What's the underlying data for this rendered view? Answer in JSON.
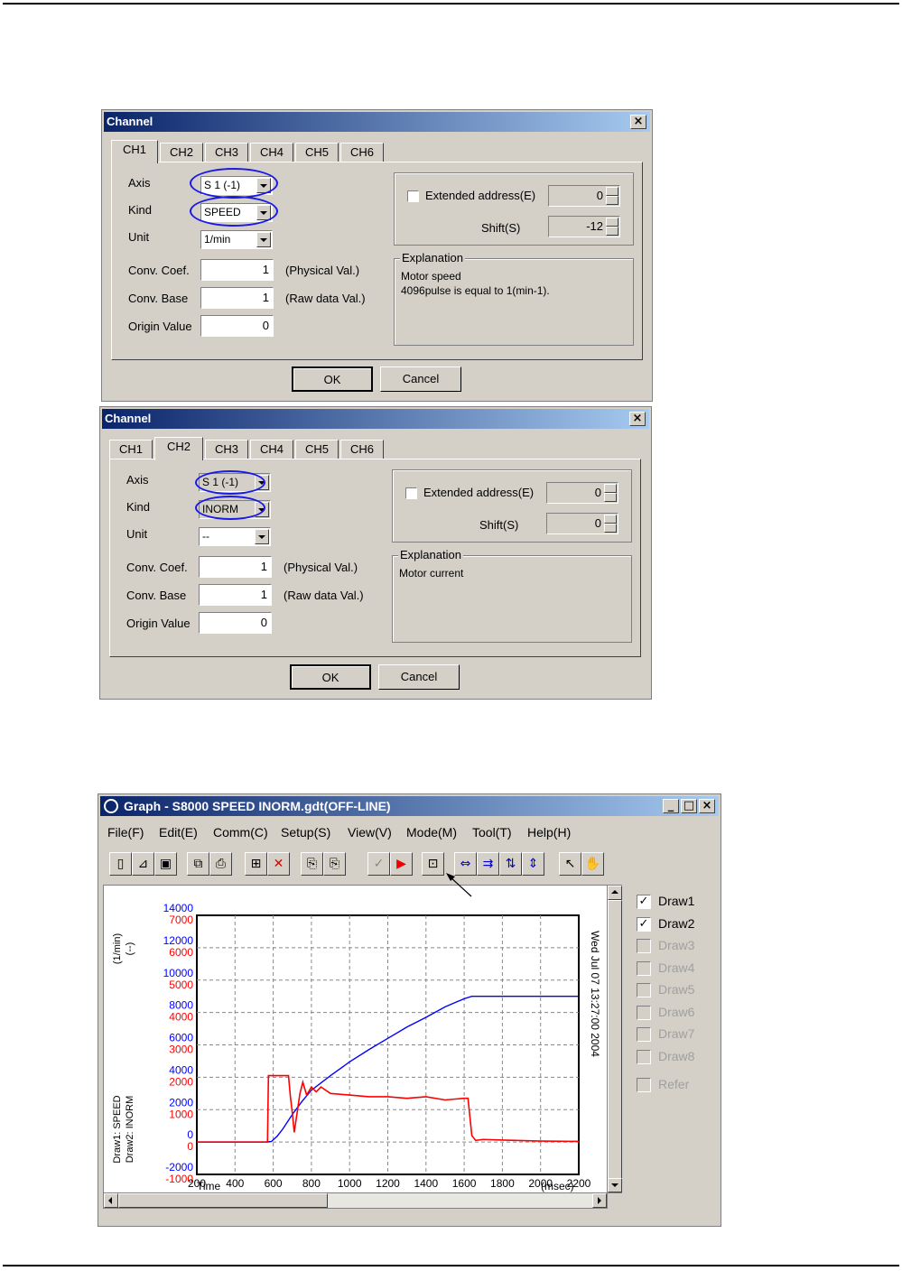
{
  "dialog1": {
    "title": "Channel",
    "tabs": [
      "CH1",
      "CH2",
      "CH3",
      "CH4",
      "CH5",
      "CH6"
    ],
    "active_tab": "CH1",
    "labels": {
      "axis": "Axis",
      "kind": "Kind",
      "unit": "Unit",
      "conv_coef": "Conv. Coef.",
      "conv_base": "Conv. Base",
      "origin": "Origin Value"
    },
    "axis_value": "S 1 (-1)",
    "kind_value": "SPEED",
    "unit_value": "1/min",
    "conv_coef": "1",
    "conv_base": "1",
    "origin_value": "0",
    "physical_suffix": "(Physical Val.)",
    "raw_suffix": "(Raw data Val.)",
    "extended_label": "Extended address(E)",
    "extended_value": "0",
    "shift_label": "Shift(S)",
    "shift_value": "-12",
    "explanation_title": "Explanation",
    "explanation_line1": "Motor speed",
    "explanation_line2": "4096pulse is equal to 1(min-1).",
    "ok": "OK",
    "cancel": "Cancel"
  },
  "dialog2": {
    "title": "Channel",
    "tabs": [
      "CH1",
      "CH2",
      "CH3",
      "CH4",
      "CH5",
      "CH6"
    ],
    "active_tab": "CH2",
    "labels": {
      "axis": "Axis",
      "kind": "Kind",
      "unit": "Unit",
      "conv_coef": "Conv. Coef.",
      "conv_base": "Conv. Base",
      "origin": "Origin Value"
    },
    "axis_value": "S 1 (-1)",
    "kind_value": "INORM",
    "unit_value": "--",
    "conv_coef": "1",
    "conv_base": "1",
    "origin_value": "0",
    "physical_suffix": "(Physical Val.)",
    "raw_suffix": "(Raw data Val.)",
    "extended_label": "Extended address(E)",
    "extended_value": "0",
    "shift_label": "Shift(S)",
    "shift_value": "0",
    "explanation_title": "Explanation",
    "explanation_line1": "Motor current",
    "explanation_line2": "",
    "ok": "OK",
    "cancel": "Cancel"
  },
  "graph": {
    "title": "Graph - S8000 SPEED INORM.gdt(OFF-LINE)",
    "menu": [
      "File(F)",
      "Edit(E)",
      "Comm(C)",
      "Setup(S)",
      "View(V)",
      "Mode(M)",
      "Tool(T)",
      "Help(H)"
    ],
    "window_buttons": [
      "_",
      "□",
      "×"
    ],
    "toolbar_icons": [
      "new-file-icon",
      "open-folder-icon",
      "save-disk-icon",
      "copy-icon",
      "print-icon",
      "channel-setup-icon",
      "delete-icon",
      "paste-icon",
      "export-icon",
      "trigger-icon",
      "play-icon",
      "fit-frame-icon",
      "zoom-x-icon",
      "shift-x-icon",
      "shift-y-icon",
      "zoom-y-icon",
      "pointer-icon",
      "hand-icon"
    ],
    "draw_items": [
      {
        "label": "Draw1",
        "checked": true,
        "enabled": true
      },
      {
        "label": "Draw2",
        "checked": true,
        "enabled": true
      },
      {
        "label": "Draw3",
        "checked": false,
        "enabled": false
      },
      {
        "label": "Draw4",
        "checked": false,
        "enabled": false
      },
      {
        "label": "Draw5",
        "checked": false,
        "enabled": false
      },
      {
        "label": "Draw6",
        "checked": false,
        "enabled": false
      },
      {
        "label": "Draw7",
        "checked": false,
        "enabled": false
      },
      {
        "label": "Draw8",
        "checked": false,
        "enabled": false
      },
      {
        "label": "Refer",
        "checked": false,
        "enabled": false
      }
    ],
    "unit_left": "(1/min)",
    "unit_right": "(--)",
    "draw_legend_1": "Draw1: SPEED",
    "draw_legend_2": "Draw2: INORM",
    "timestamp": "Wed Jul 07 13:27:00 2004",
    "colors": {
      "speed": "#0000ff",
      "inorm": "#ff0000"
    }
  },
  "chart_data": {
    "type": "line",
    "xlabel": "Time",
    "x_unit": "(msec)",
    "xlim": [
      200,
      2200
    ],
    "x_ticks": [
      200,
      400,
      600,
      800,
      1000,
      1200,
      1400,
      1600,
      1800,
      2000,
      2200
    ],
    "y_ticks_speed": [
      -2000,
      0,
      2000,
      4000,
      6000,
      8000,
      10000,
      12000,
      14000
    ],
    "y_ticks_inorm": [
      -1000,
      0,
      1000,
      2000,
      3000,
      4000,
      5000,
      6000,
      7000
    ],
    "ylim_speed": [
      -2000,
      14000
    ],
    "ylim_inorm": [
      -1000,
      7000
    ],
    "grid": true,
    "series": [
      {
        "name": "SPEED",
        "color": "#0000ff",
        "x": [
          200,
          560,
          590,
          620,
          650,
          700,
          750,
          800,
          900,
          1000,
          1100,
          1200,
          1300,
          1400,
          1500,
          1600,
          1640,
          1800,
          2000,
          2200
        ],
        "y": [
          0,
          0,
          30,
          350,
          800,
          1700,
          2500,
          3200,
          4100,
          4950,
          5700,
          6400,
          7100,
          7700,
          8350,
          8850,
          9000,
          9000,
          9000,
          9000
        ]
      },
      {
        "name": "INORM",
        "color": "#ff0000",
        "x": [
          200,
          570,
          575,
          680,
          690,
          700,
          710,
          725,
          740,
          755,
          775,
          800,
          825,
          850,
          900,
          1000,
          1100,
          1200,
          1300,
          1400,
          1500,
          1600,
          1620,
          1640,
          1660,
          1700,
          1800,
          2000,
          2200
        ],
        "y": [
          0,
          0,
          2050,
          2050,
          1400,
          900,
          300,
          900,
          1500,
          1850,
          1450,
          1700,
          1550,
          1700,
          1500,
          1450,
          1400,
          1400,
          1350,
          1400,
          1300,
          1350,
          1350,
          200,
          50,
          80,
          60,
          30,
          20
        ]
      }
    ]
  }
}
